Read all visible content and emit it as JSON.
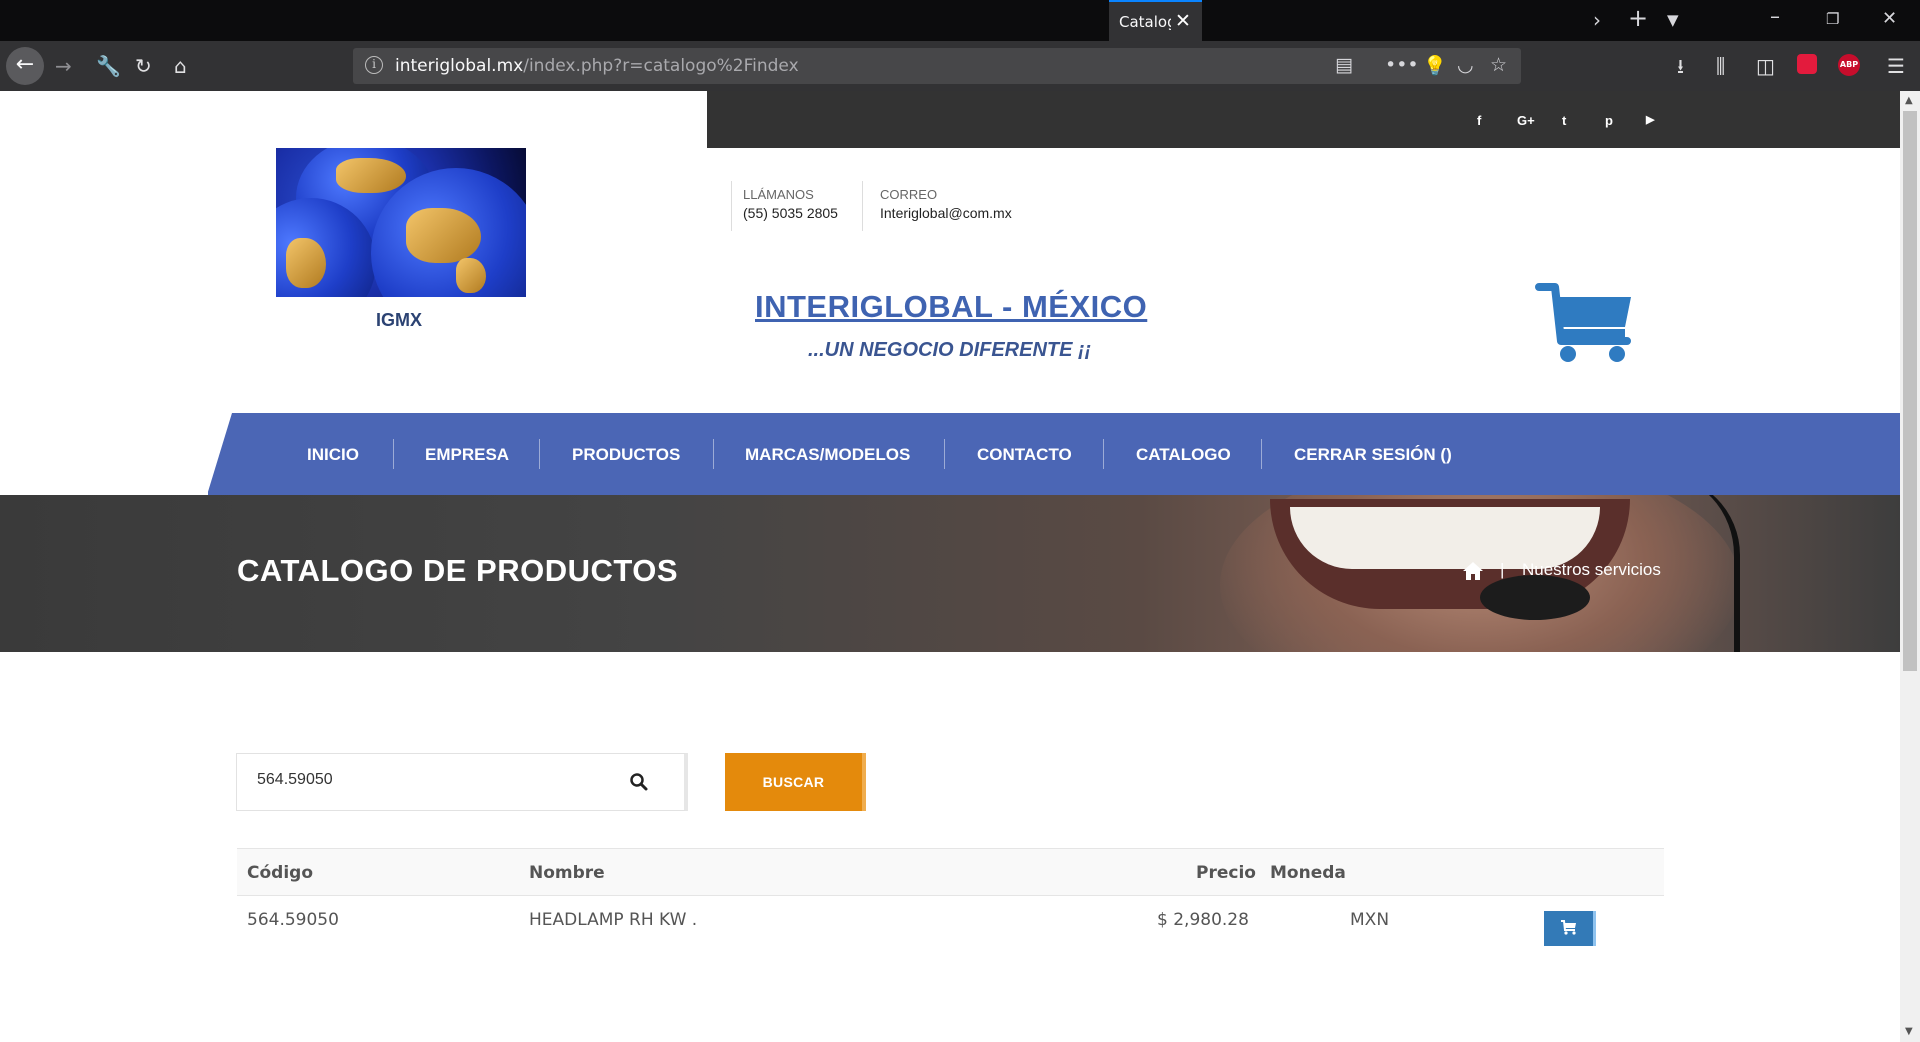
{
  "browser": {
    "tab_title": "Catalog",
    "url_host": "interiglobal.mx",
    "url_path": "/index.php?r=catalogo%2Findex",
    "abp_label": "ABP"
  },
  "header": {
    "logo_text": "IGMX",
    "social_icons": [
      "facebook-icon",
      "google-plus-icon",
      "twitter-icon",
      "pinterest-icon",
      "youtube-icon"
    ],
    "social_glyphs": {
      "facebook": "f",
      "google": "G+",
      "twitter": "t",
      "pinterest": "p",
      "youtube": "▶"
    },
    "phone_label": "LLÁMANOS",
    "phone_value": "(55) 5035 2805",
    "email_label": "CORREO",
    "email_value": "Interiglobal@com.mx",
    "brand_title": "INTERIGLOBAL - MÉXICO",
    "brand_slogan": "...UN NEGOCIO DIFERENTE ¡¡"
  },
  "menu": {
    "items": [
      "INICIO",
      "EMPRESA",
      "PRODUCTOS",
      "MARCAS/MODELOS",
      "CONTACTO",
      "CATALOGO",
      "CERRAR SESIÓN ()"
    ]
  },
  "hero": {
    "title": "CATALOGO DE PRODUCTOS",
    "breadcrumb_sep": "|",
    "breadcrumb_label": "Nuestros servicios"
  },
  "search": {
    "value": "564.59050",
    "button_label": "BUSCAR"
  },
  "table": {
    "headers": [
      "Código",
      "Nombre",
      "Precio",
      "Moneda"
    ],
    "rows": [
      {
        "codigo": "564.59050",
        "nombre": "HEADLAMP RH KW .",
        "precio": "$ 2,980.28",
        "moneda": "MXN"
      }
    ]
  },
  "colors": {
    "menu_bg": "#4b66b5",
    "brand": "#3f63b1",
    "buscar_bg": "#e48a0c",
    "cart_btn": "#337ab7",
    "cart_icon": "#2f7bc1"
  }
}
